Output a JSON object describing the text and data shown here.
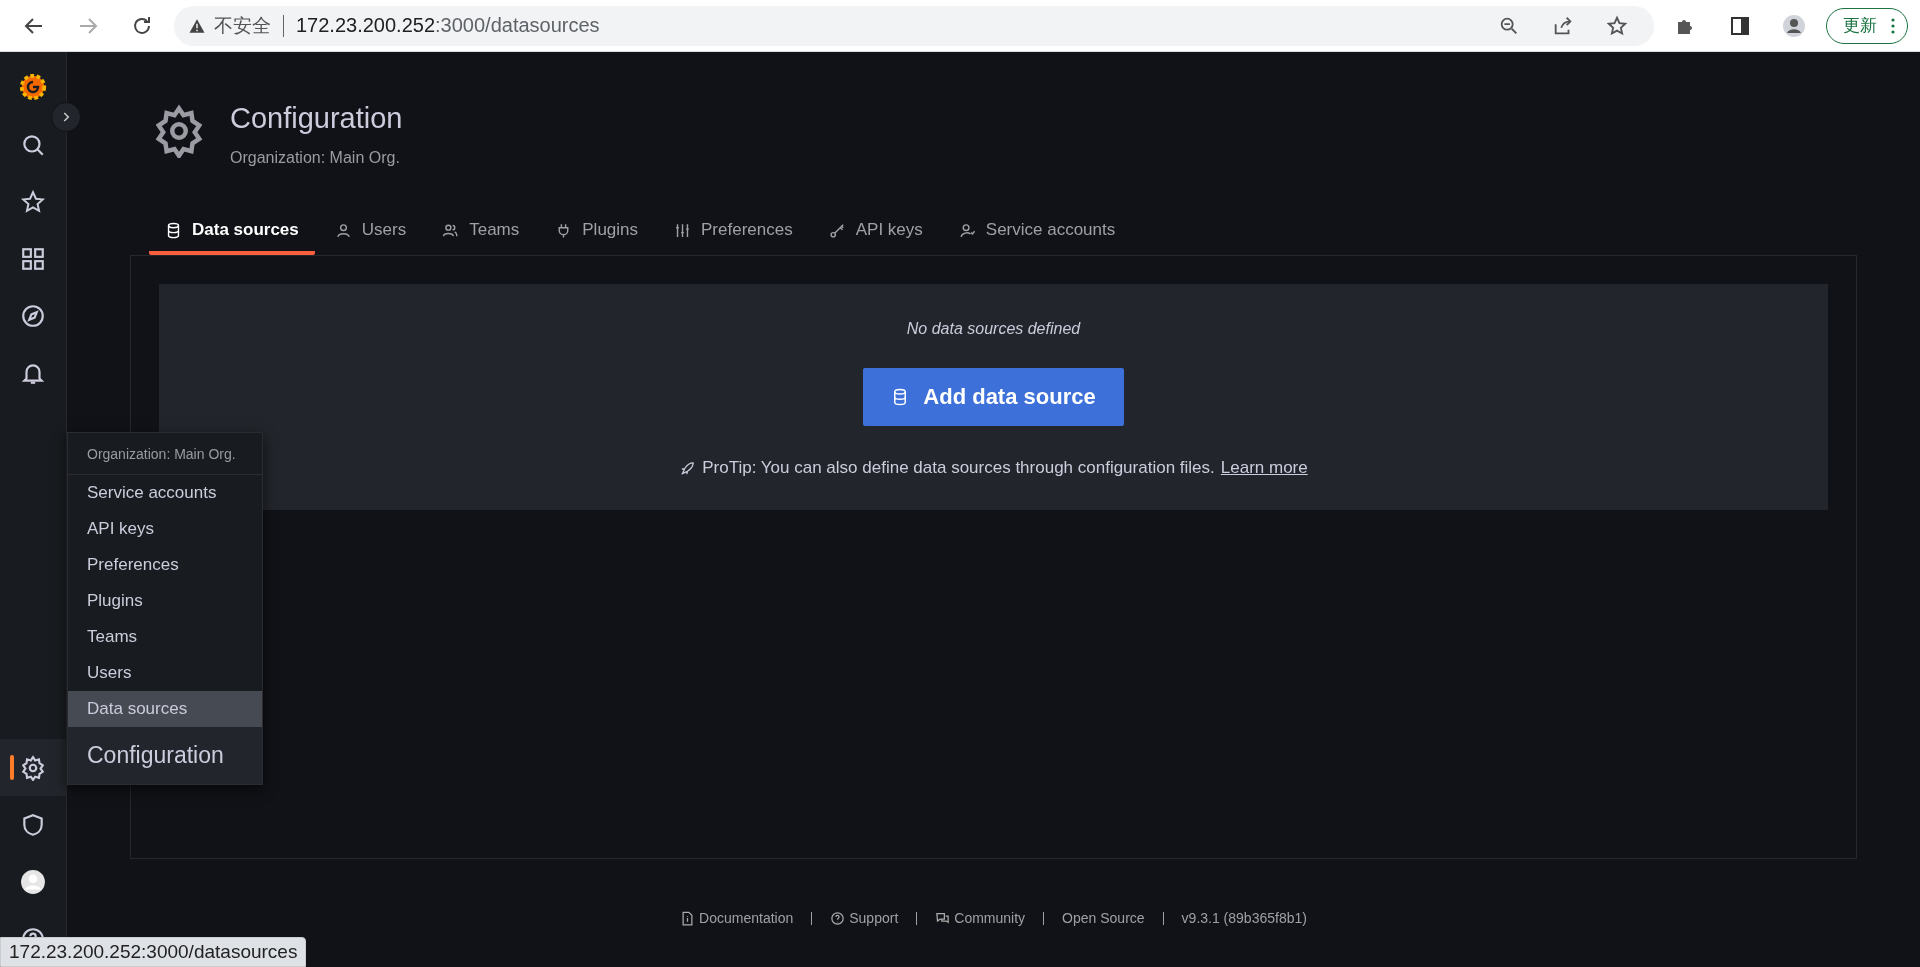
{
  "browser": {
    "security_label": "不安全",
    "url_host": "172.23.200.252",
    "url_path": ":3000/datasources",
    "update_button": "更新"
  },
  "sidebar": {
    "items": [
      {
        "selected": false
      },
      {
        "selected": false
      },
      {
        "selected": false
      },
      {
        "selected": false
      },
      {
        "selected": false
      },
      {
        "selected": true
      },
      {
        "selected": false
      },
      {
        "selected": false
      },
      {
        "selected": false
      }
    ]
  },
  "header": {
    "title": "Configuration",
    "subtitle": "Organization: Main Org."
  },
  "tabs": [
    {
      "label": "Data sources",
      "selected": true
    },
    {
      "label": "Users",
      "selected": false
    },
    {
      "label": "Teams",
      "selected": false
    },
    {
      "label": "Plugins",
      "selected": false
    },
    {
      "label": "Preferences",
      "selected": false
    },
    {
      "label": "API keys",
      "selected": false
    },
    {
      "label": "Service accounts",
      "selected": false
    }
  ],
  "empty_state": {
    "message": "No data sources defined",
    "button": "Add data source",
    "protip": "ProTip: You can also define data sources through configuration files.",
    "link": "Learn more"
  },
  "footer": [
    "Documentation",
    "Support",
    "Community",
    "Open Source",
    "v9.3.1 (89b365f8b1)"
  ],
  "flyout": {
    "header": "Organization: Main Org.",
    "items": [
      {
        "label": "Service accounts",
        "selected": false
      },
      {
        "label": "API keys",
        "selected": false
      },
      {
        "label": "Preferences",
        "selected": false
      },
      {
        "label": "Plugins",
        "selected": false
      },
      {
        "label": "Teams",
        "selected": false
      },
      {
        "label": "Users",
        "selected": false
      },
      {
        "label": "Data sources",
        "selected": true
      }
    ],
    "title": "Configuration"
  },
  "status_url": "172.23.200.252:3000/datasources"
}
